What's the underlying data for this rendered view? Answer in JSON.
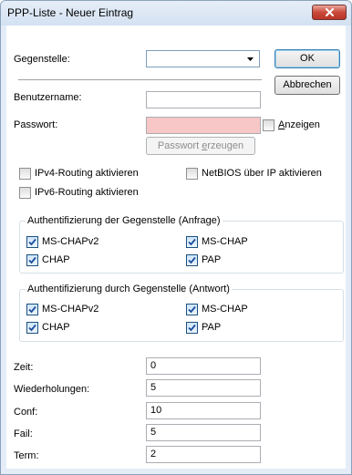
{
  "window": {
    "title": "PPP-Liste - Neuer Eintrag"
  },
  "fields": {
    "gegenstelle": {
      "label": "Gegenstelle:",
      "value": ""
    },
    "benutzername": {
      "label": "Benutzername:",
      "value": ""
    },
    "passwort": {
      "label": "Passwort:",
      "value": ""
    }
  },
  "buttons": {
    "ok": "OK",
    "abbrechen": "Abbrechen",
    "passwort_erzeugen_pre": "Passwort ",
    "passwort_erzeugen_key": "e",
    "passwort_erzeugen_post": "rzeugen"
  },
  "anzeigen": {
    "key": "A",
    "rest": "nzeigen",
    "checked": false
  },
  "options": {
    "ipv4": {
      "label": "IPv4-Routing aktivieren",
      "checked": false
    },
    "netbios": {
      "label": "NetBIOS über IP aktivieren",
      "checked": false
    },
    "ipv6": {
      "label": "IPv6-Routing aktivieren",
      "checked": false
    }
  },
  "group_request": {
    "title": "Authentifizierung der Gegenstelle (Anfrage)",
    "items": [
      {
        "label": "MS-CHAPv2",
        "checked": true
      },
      {
        "label": "MS-CHAP",
        "checked": true
      },
      {
        "label": "CHAP",
        "checked": true
      },
      {
        "label": "PAP",
        "checked": true
      }
    ]
  },
  "group_response": {
    "title": "Authentifizierung durch Gegenstelle (Antwort)",
    "items": [
      {
        "label": "MS-CHAPv2",
        "checked": true
      },
      {
        "label": "MS-CHAP",
        "checked": true
      },
      {
        "label": "CHAP",
        "checked": true
      },
      {
        "label": "PAP",
        "checked": true
      }
    ]
  },
  "timers": [
    {
      "label": "Zeit:",
      "value": "0"
    },
    {
      "label": "Wiederholungen:",
      "value": "5"
    },
    {
      "label": "Conf:",
      "value": "10"
    },
    {
      "label": "Fail:",
      "value": "5"
    },
    {
      "label": "Term:",
      "value": "2"
    }
  ],
  "colors": {
    "password_invalid_bg": "#f7c6c6",
    "checkmark": "#1c4e9c",
    "close_button": "#c9493a"
  },
  "icons": {
    "close": "close-icon",
    "dropdown": "chevron-down-icon",
    "check": "checkmark-icon"
  }
}
